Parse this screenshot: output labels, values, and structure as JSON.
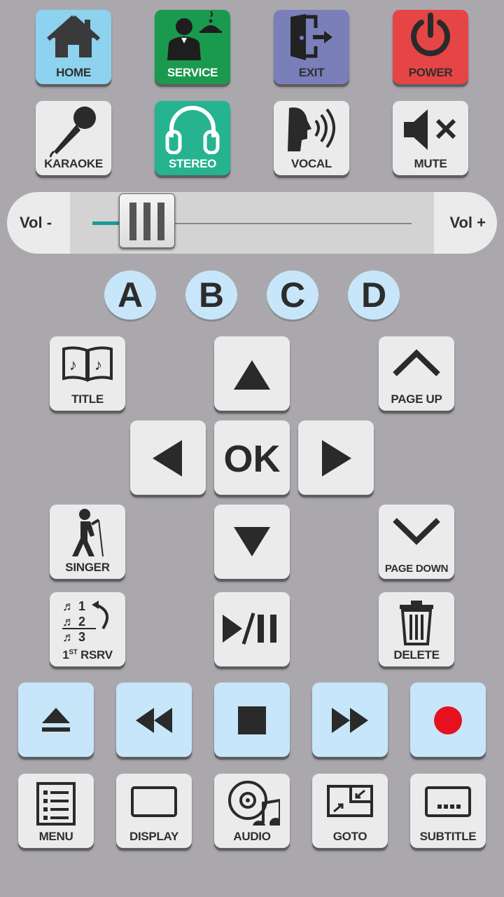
{
  "row1": [
    {
      "label": "HOME",
      "icon": "home-icon"
    },
    {
      "label": "SERVICE",
      "icon": "waiter-icon"
    },
    {
      "label": "EXIT",
      "icon": "exit-door-icon"
    },
    {
      "label": "POWER",
      "icon": "power-icon"
    }
  ],
  "row2": [
    {
      "label": "KARAOKE",
      "icon": "microphone-icon"
    },
    {
      "label": "STEREO",
      "icon": "headphones-icon"
    },
    {
      "label": "VOCAL",
      "icon": "speaking-head-icon"
    },
    {
      "label": "MUTE",
      "icon": "mute-icon"
    }
  ],
  "volume": {
    "minus_label": "Vol -",
    "plus_label": "Vol +",
    "level": 0.1
  },
  "abcd": [
    "A",
    "B",
    "C",
    "D"
  ],
  "nav": {
    "title": "TITLE",
    "page_up": "PAGE UP",
    "ok": "OK",
    "singer": "SINGER",
    "page_down": "PAGE DOWN",
    "reserve": "1ST RSRV",
    "reserve_main": "1",
    "reserve_sup": "ST",
    "reserve_rest": " RSRV",
    "delete": "DELETE"
  },
  "transport": [
    "eject",
    "rewind",
    "stop",
    "fast-forward",
    "record"
  ],
  "bottom": [
    {
      "label": "MENU"
    },
    {
      "label": "DISPLAY"
    },
    {
      "label": "AUDIO"
    },
    {
      "label": "GOTO"
    },
    {
      "label": "SUBTITLE"
    }
  ],
  "colors": {
    "record": "#e8101e",
    "teal": "#1a9a93"
  }
}
